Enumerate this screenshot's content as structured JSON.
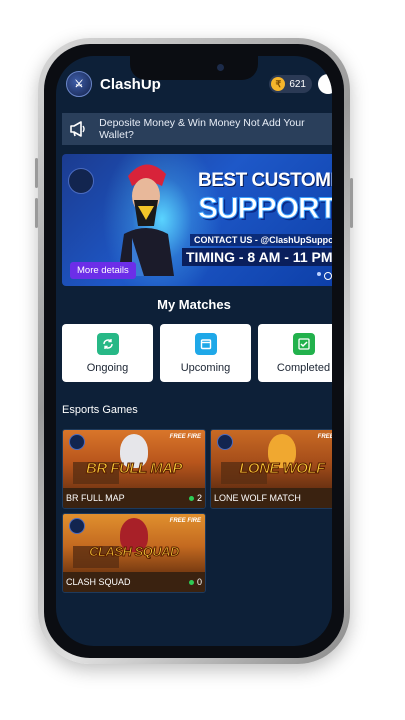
{
  "header": {
    "app_title": "ClashUp",
    "coins": "621"
  },
  "notice": {
    "text": "Deposite Money & Win Money Not Add Your Wallet?"
  },
  "banner": {
    "line1": "BEST CUSTOMER",
    "line2": "SUPPORT",
    "contact": "CONTACT US - @ClashUpSupport",
    "timing": "TIMING - 8 AM - 11 PM",
    "button": "More details"
  },
  "matches": {
    "title": "My Matches",
    "tabs": [
      {
        "label": "Ongoing",
        "icon": "refresh-icon",
        "color": "#27b886"
      },
      {
        "label": "Upcoming",
        "icon": "calendar-icon",
        "color": "#1fa8e8"
      },
      {
        "label": "Completed",
        "icon": "check-icon",
        "color": "#22b14c"
      }
    ]
  },
  "esports": {
    "title": "Esports Games",
    "games": [
      {
        "art_title": "BR FULL MAP",
        "name": "BR FULL MAP",
        "count": "2"
      },
      {
        "art_title": "LONE WOLF",
        "name": "LONE WOLF MATCH",
        "count": ""
      },
      {
        "art_title": "CLASH SQUAD",
        "name": "CLASH SQUAD",
        "count": "0"
      }
    ]
  },
  "brand_logo_text": "CLASHUP"
}
